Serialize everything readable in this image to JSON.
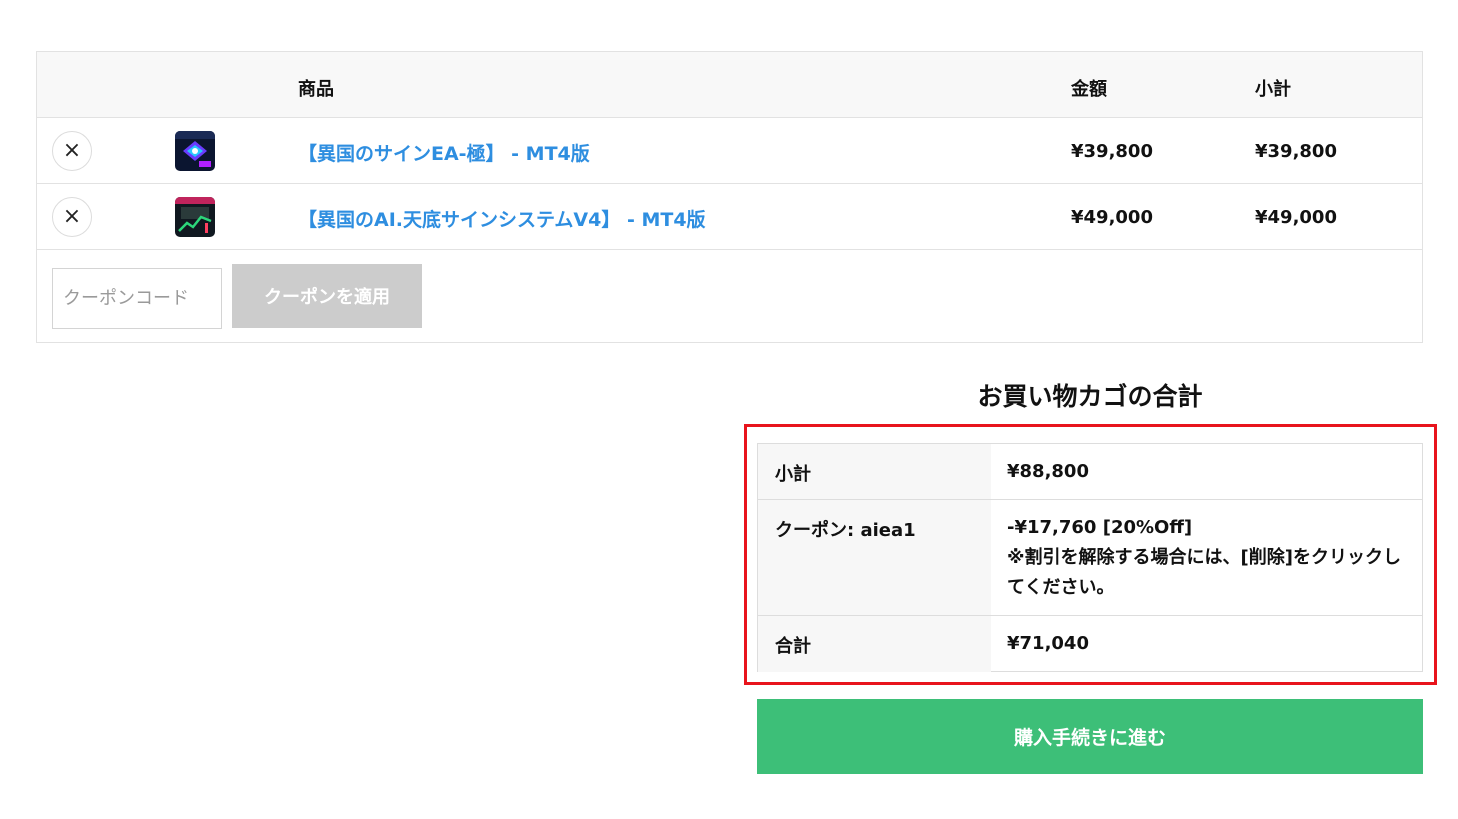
{
  "cart": {
    "headers": {
      "product": "商品",
      "price": "金額",
      "subtotal": "小計"
    },
    "items": [
      {
        "remove_icon": "×",
        "name": "【異国のサインEA-極】 - MT4版",
        "price": "¥39,800",
        "subtotal": "¥39,800"
      },
      {
        "remove_icon": "×",
        "name": "【異国のAI.天底サインシステムV4】 - MT4版",
        "price": "¥49,000",
        "subtotal": "¥49,000"
      }
    ],
    "coupon": {
      "placeholder": "クーポンコード",
      "value": "",
      "apply_label": "クーポンを適用"
    }
  },
  "totals": {
    "title": "お買い物カゴの合計",
    "subtotal_label": "小計",
    "subtotal_value": "¥88,800",
    "coupon_label": "クーポン: aiea1",
    "coupon_value": "-¥17,760 [20%Off]",
    "coupon_note": "※割引を解除する場合には、[削除]をクリックしてください。",
    "total_label": "合計",
    "total_value": "¥71,040"
  },
  "checkout": {
    "label": "購入手続きに進む"
  },
  "colors": {
    "link": "#2e8ee0",
    "checkout_button": "#3dbf78",
    "coupon_button": "#cccccc",
    "highlight_border": "#e8141c"
  }
}
